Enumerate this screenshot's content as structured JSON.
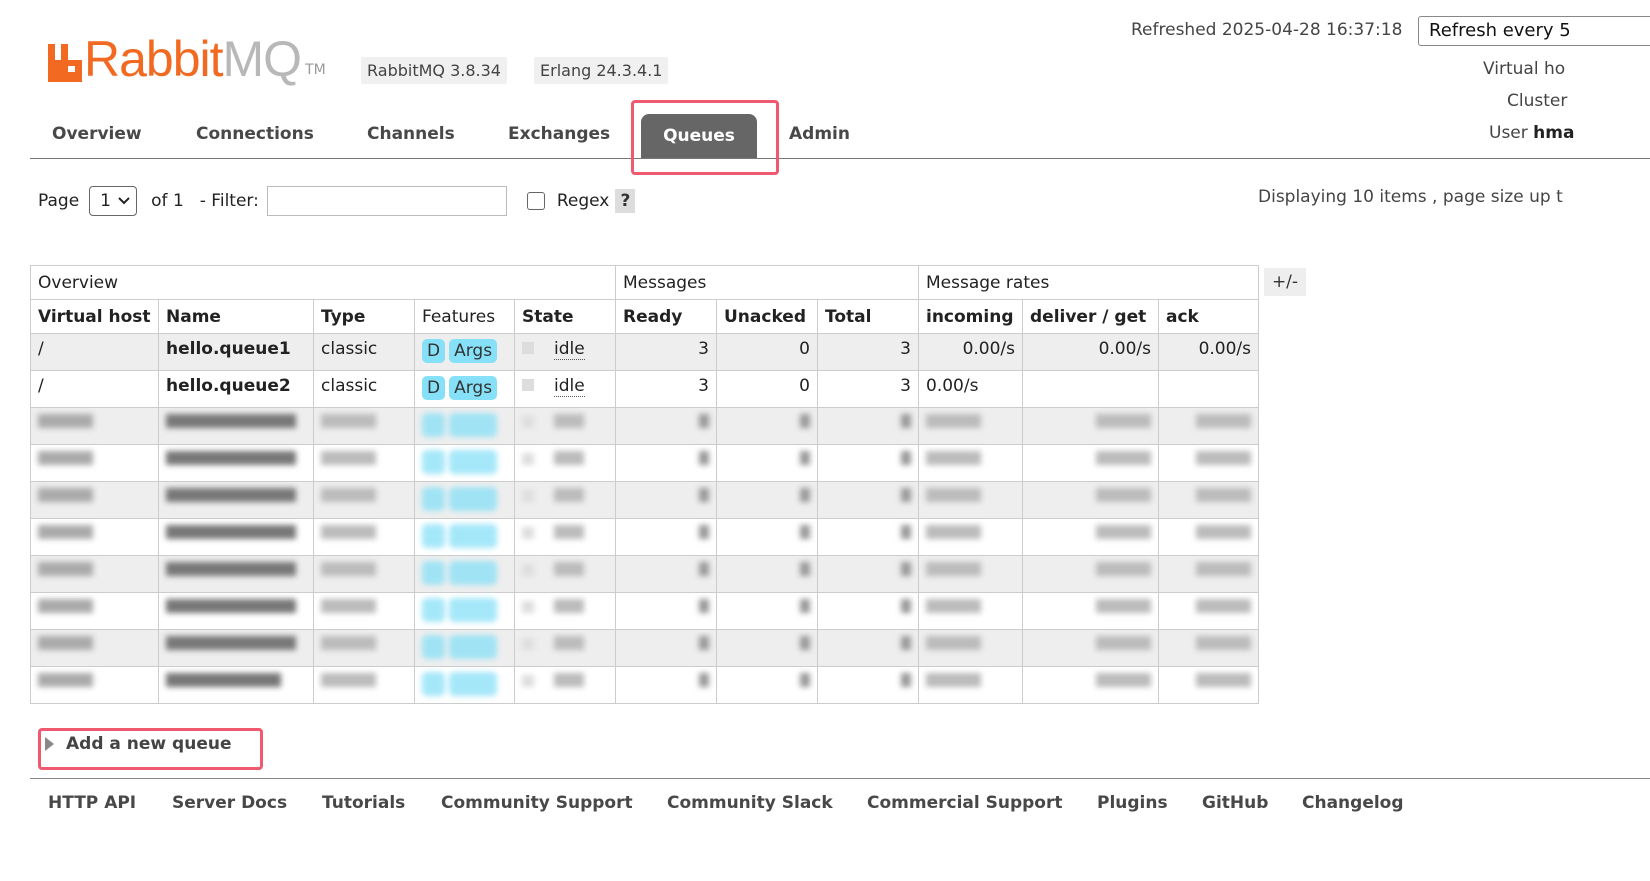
{
  "header": {
    "logo": {
      "rabbit": "Rabbit",
      "mq": "MQ",
      "tm": "TM"
    },
    "version": "RabbitMQ 3.8.34",
    "erlang": "Erlang 24.3.4.1",
    "refreshed": "Refreshed 2025-04-28 16:37:18",
    "refresh_select": "Refresh every 5",
    "virtual_host_label": "Virtual ho",
    "cluster_label": "Cluster",
    "user_label": "User ",
    "user_value": "hma",
    "brand_color": "#f26a21"
  },
  "tabs": [
    {
      "label": "Overview"
    },
    {
      "label": "Connections"
    },
    {
      "label": "Channels"
    },
    {
      "label": "Exchanges"
    },
    {
      "label": "Queues",
      "active": true
    },
    {
      "label": "Admin"
    }
  ],
  "pager": {
    "page_label": "Page",
    "page_value": "1",
    "of_label": "of 1",
    "filter_label": "- Filter:",
    "filter_value": "",
    "regex_label": "Regex",
    "help": "?",
    "displaying": "Displaying 10 items , page size up t"
  },
  "table": {
    "groups": [
      "Overview",
      "Messages",
      "Message rates"
    ],
    "columns": [
      "Virtual host",
      "Name",
      "Type",
      "Features",
      "State",
      "Ready",
      "Unacked",
      "Total",
      "incoming",
      "deliver / get",
      "ack"
    ],
    "toggle": "+/-",
    "rows": [
      {
        "vhost": "/",
        "name": "hello.queue1",
        "type": "classic",
        "tags": [
          "D",
          "Args"
        ],
        "state": "idle",
        "ready": "3",
        "unacked": "0",
        "total": "3",
        "incoming": "0.00/s",
        "deliver": "0.00/s",
        "ack": "0.00/s"
      },
      {
        "vhost": "/",
        "name": "hello.queue2",
        "type": "classic",
        "tags": [
          "D",
          "Args"
        ],
        "state": "idle",
        "ready": "3",
        "unacked": "0",
        "total": "3",
        "incoming": "0.00/s",
        "deliver": "",
        "ack": ""
      }
    ]
  },
  "add_queue": "Add a new queue",
  "footer": [
    "HTTP API",
    "Server Docs",
    "Tutorials",
    "Community Support",
    "Community Slack",
    "Commercial Support",
    "Plugins",
    "GitHub",
    "Changelog"
  ]
}
